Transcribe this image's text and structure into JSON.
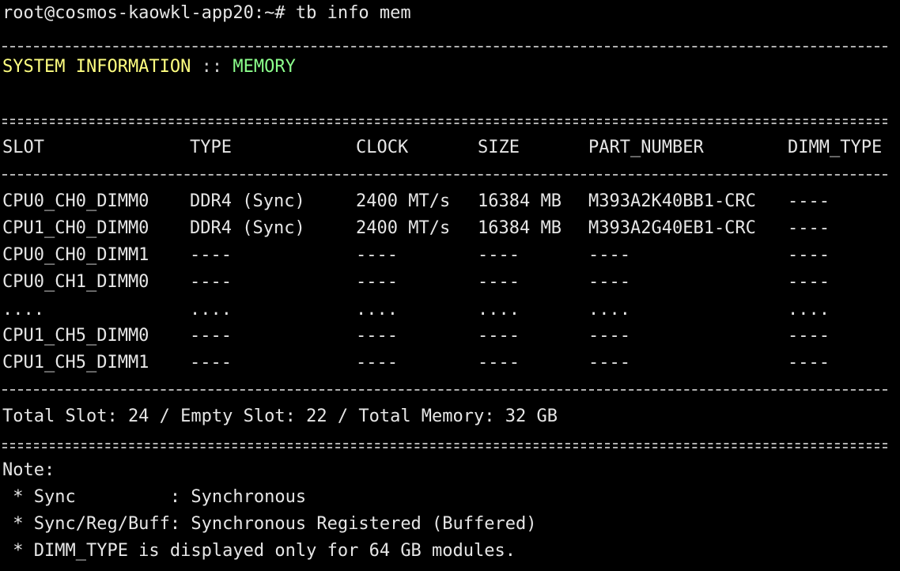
{
  "prompt": {
    "text": "root@cosmos-kaowkl-app20:~# tb info mem"
  },
  "section": {
    "label": "SYSTEM INFORMATION",
    "separator": " :: ",
    "name": "MEMORY"
  },
  "table": {
    "headers": {
      "slot": "SLOT",
      "type": "TYPE",
      "clock": "CLOCK",
      "size": "SIZE",
      "part": "PART_NUMBER",
      "dimm": "DIMM_TYPE"
    },
    "rows": [
      {
        "slot": "CPU0_CH0_DIMM0",
        "type": "DDR4 (Sync)",
        "clock": "2400 MT/s",
        "size": "16384 MB",
        "part": "M393A2K40BB1-CRC",
        "dimm": "----"
      },
      {
        "slot": "CPU1_CH0_DIMM0",
        "type": "DDR4 (Sync)",
        "clock": "2400 MT/s",
        "size": "16384 MB",
        "part": "M393A2G40EB1-CRC",
        "dimm": "----"
      },
      {
        "slot": "CPU0_CH0_DIMM1",
        "type": "----",
        "clock": "----",
        "size": "----",
        "part": "----",
        "dimm": "----"
      },
      {
        "slot": "CPU0_CH1_DIMM0",
        "type": "----",
        "clock": "----",
        "size": "----",
        "part": "----",
        "dimm": "----"
      },
      {
        "slot": "....",
        "type": "....",
        "clock": "....",
        "size": "....",
        "part": "....",
        "dimm": "...."
      },
      {
        "slot": "CPU1_CH5_DIMM0",
        "type": "----",
        "clock": "----",
        "size": "----",
        "part": "----",
        "dimm": "----"
      },
      {
        "slot": "CPU1_CH5_DIMM1",
        "type": "----",
        "clock": "----",
        "size": "----",
        "part": "----",
        "dimm": "----"
      }
    ]
  },
  "summary": {
    "text": "Total Slot: 24 / Empty Slot: 22 / Total Memory: 32 GB"
  },
  "notes": {
    "title": "Note:",
    "items": [
      " * Sync         : Synchronous",
      " * Sync/Reg/Buff: Synchronous Registered (Buffered)",
      " * DIMM_TYPE is displayed only for 64 GB modules."
    ]
  },
  "colors": {
    "background": "#000000",
    "foreground": "#e6e6e6",
    "section_label": "#ffff80",
    "section_name": "#8cff8c"
  }
}
